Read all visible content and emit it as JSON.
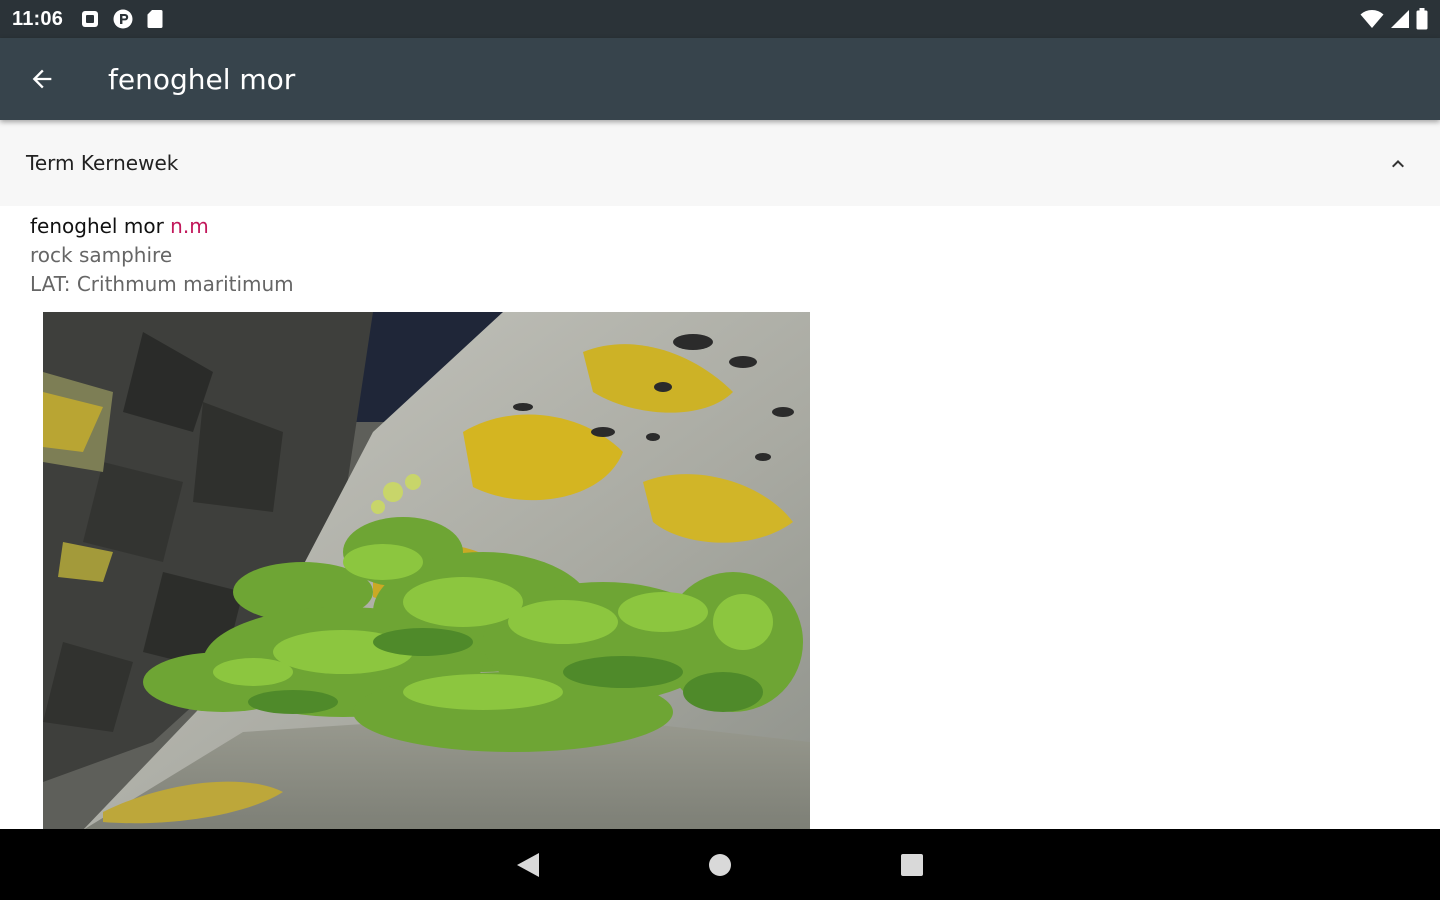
{
  "status_bar": {
    "time": "11:06",
    "left_icons": [
      "notification-square-icon",
      "p-circle-icon",
      "sd-card-icon"
    ],
    "right_icons": [
      "wifi-icon",
      "cell-signal-icon",
      "battery-icon"
    ]
  },
  "app_bar": {
    "title": "fenoghel mor",
    "back_icon": "arrow-back-icon"
  },
  "section": {
    "title": "Term Kernewek",
    "toggle_icon": "chevron-up-icon"
  },
  "entry": {
    "term": "fenoghel mor",
    "part_of_speech": "n.m",
    "translation": "rock samphire",
    "latin": "LAT: Crithmum maritimum"
  },
  "photo": {
    "icon": "samphire-photo"
  },
  "nav_bar": {
    "back_icon": "nav-back-triangle-icon",
    "home_icon": "nav-home-circle-icon",
    "recents_icon": "nav-recents-square-icon"
  },
  "colors": {
    "status_bar": "#2b3338",
    "app_bar": "#37444c",
    "section_bg": "#f7f7f7",
    "pos_accent": "#c2185b",
    "gloss_text": "#666666"
  }
}
